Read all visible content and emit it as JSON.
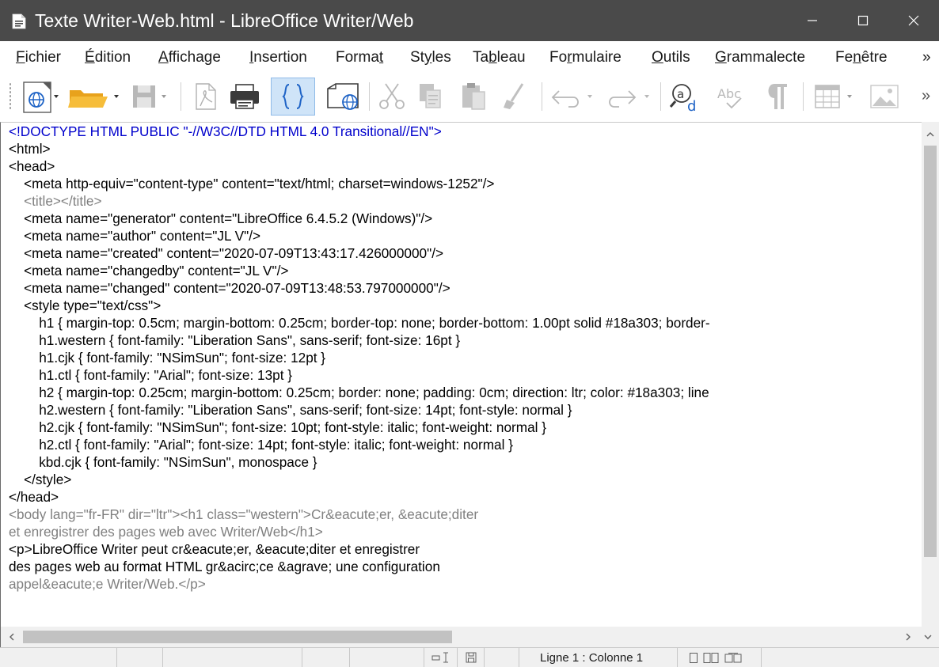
{
  "window": {
    "title": "Texte Writer-Web.html - LibreOffice Writer/Web",
    "buttons": {
      "minimize": "minimize-icon",
      "maximize": "maximize-icon",
      "close": "close-icon"
    }
  },
  "menubar": {
    "items": [
      {
        "pre": "",
        "acc": "F",
        "post": "ichier"
      },
      {
        "pre": "",
        "acc": "É",
        "post": "dition"
      },
      {
        "pre": "",
        "acc": "A",
        "post": "ffichage"
      },
      {
        "pre": "",
        "acc": "I",
        "post": "nsertion"
      },
      {
        "pre": "Forma",
        "acc": "t",
        "post": ""
      },
      {
        "pre": "St",
        "acc": "y",
        "post": "les"
      },
      {
        "pre": "Ta",
        "acc": "b",
        "post": "leau"
      },
      {
        "pre": "Fo",
        "acc": "r",
        "post": "mulaire"
      },
      {
        "pre": "",
        "acc": "O",
        "post": "utils"
      },
      {
        "pre": "",
        "acc": "G",
        "post": "rammalecte"
      },
      {
        "pre": "Fe",
        "acc": "n",
        "post": "être"
      }
    ],
    "overflow": "»"
  },
  "toolbar": {
    "icons": [
      "web-view-icon",
      "open-folder-icon",
      "save-icon",
      "export-pdf-icon",
      "print-icon",
      "html-source-icon",
      "web-layout-icon",
      "cut-icon",
      "copy-icon",
      "paste-icon",
      "clone-formatting-icon",
      "undo-icon",
      "redo-icon",
      "find-replace-icon",
      "spellcheck-icon",
      "formatting-marks-icon",
      "insert-table-icon",
      "insert-image-icon"
    ],
    "spellcheck_label": "Abc",
    "overflow": "»"
  },
  "source": {
    "lines": [
      {
        "text": "<!DOCTYPE HTML PUBLIC \"-//W3C//DTD HTML 4.0 Transitional//EN\">",
        "color": "blue"
      },
      {
        "text": "<html>",
        "color": "black"
      },
      {
        "text": "<head>",
        "color": "black"
      },
      {
        "text": "    <meta http-equiv=\"content-type\" content=\"text/html; charset=windows-1252\"/>",
        "color": "black"
      },
      {
        "text": "    <title></title>",
        "color": "gray"
      },
      {
        "text": "    <meta name=\"generator\" content=\"LibreOffice 6.4.5.2 (Windows)\"/>",
        "color": "black"
      },
      {
        "text": "    <meta name=\"author\" content=\"JL V\"/>",
        "color": "black"
      },
      {
        "text": "    <meta name=\"created\" content=\"2020-07-09T13:43:17.426000000\"/>",
        "color": "black"
      },
      {
        "text": "    <meta name=\"changedby\" content=\"JL V\"/>",
        "color": "black"
      },
      {
        "text": "    <meta name=\"changed\" content=\"2020-07-09T13:48:53.797000000\"/>",
        "color": "black"
      },
      {
        "text": "    <style type=\"text/css\">",
        "color": "black"
      },
      {
        "text": "        h1 { margin-top: 0.5cm; margin-bottom: 0.25cm; border-top: none; border-bottom: 1.00pt solid #18a303; border-",
        "color": "black"
      },
      {
        "text": "        h1.western { font-family: \"Liberation Sans\", sans-serif; font-size: 16pt }",
        "color": "black"
      },
      {
        "text": "        h1.cjk { font-family: \"NSimSun\"; font-size: 12pt }",
        "color": "black"
      },
      {
        "text": "        h1.ctl { font-family: \"Arial\"; font-size: 13pt }",
        "color": "black"
      },
      {
        "text": "        h2 { margin-top: 0.25cm; margin-bottom: 0.25cm; border: none; padding: 0cm; direction: ltr; color: #18a303; line",
        "color": "black"
      },
      {
        "text": "        h2.western { font-family: \"Liberation Sans\", sans-serif; font-size: 14pt; font-style: normal }",
        "color": "black"
      },
      {
        "text": "        h2.cjk { font-family: \"NSimSun\"; font-size: 10pt; font-style: italic; font-weight: normal }",
        "color": "black"
      },
      {
        "text": "        h2.ctl { font-family: \"Arial\"; font-size: 14pt; font-style: italic; font-weight: normal }",
        "color": "black"
      },
      {
        "text": "        kbd.cjk { font-family: \"NSimSun\", monospace }",
        "color": "black"
      },
      {
        "text": "    </style>",
        "color": "black"
      },
      {
        "text": "</head>",
        "color": "black"
      },
      {
        "text": "<body lang=\"fr-FR\" dir=\"ltr\"><h1 class=\"western\">Cr&eacute;er, &eacute;diter",
        "color": "gray"
      },
      {
        "text": "et enregistrer des pages web avec Writer/Web</h1>",
        "color": "gray"
      },
      {
        "text": "<p>LibreOffice Writer peut cr&eacute;er, &eacute;diter et enregistrer",
        "color": "black"
      },
      {
        "text": "des pages web au format HTML gr&acirc;ce &agrave; une configuration",
        "color": "black"
      },
      {
        "text": "appel&eacute;e Writer/Web.</p>",
        "color": "gray"
      }
    ]
  },
  "statusbar": {
    "position": "Ligne 1 : Colonne 1"
  }
}
